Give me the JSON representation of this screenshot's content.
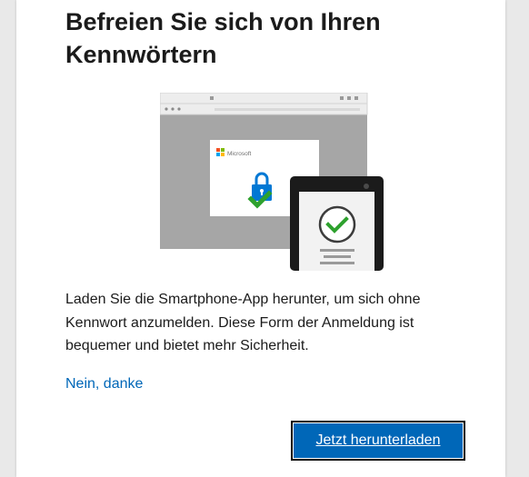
{
  "dialog": {
    "title": "Befreien Sie sich von Ihren Kennwörtern",
    "description": "Laden Sie die Smartphone-App herunter, um sich ohne Kennwort anzumelden. Diese Form der Anmeldung ist bequemer und bietet mehr Sicherheit.",
    "decline_link": "Nein, danke",
    "download_button": "Jetzt herunterladen"
  },
  "illustration": {
    "brand_label": "Microsoft",
    "icons": [
      "browser-window-icon",
      "padlock-icon",
      "checkmark-icon",
      "smartphone-icon"
    ]
  },
  "colors": {
    "accent": "#0067b8",
    "check_green": "#2ea12e",
    "lock_blue": "#0078d4",
    "browser_gray": "#a6a6a6"
  }
}
